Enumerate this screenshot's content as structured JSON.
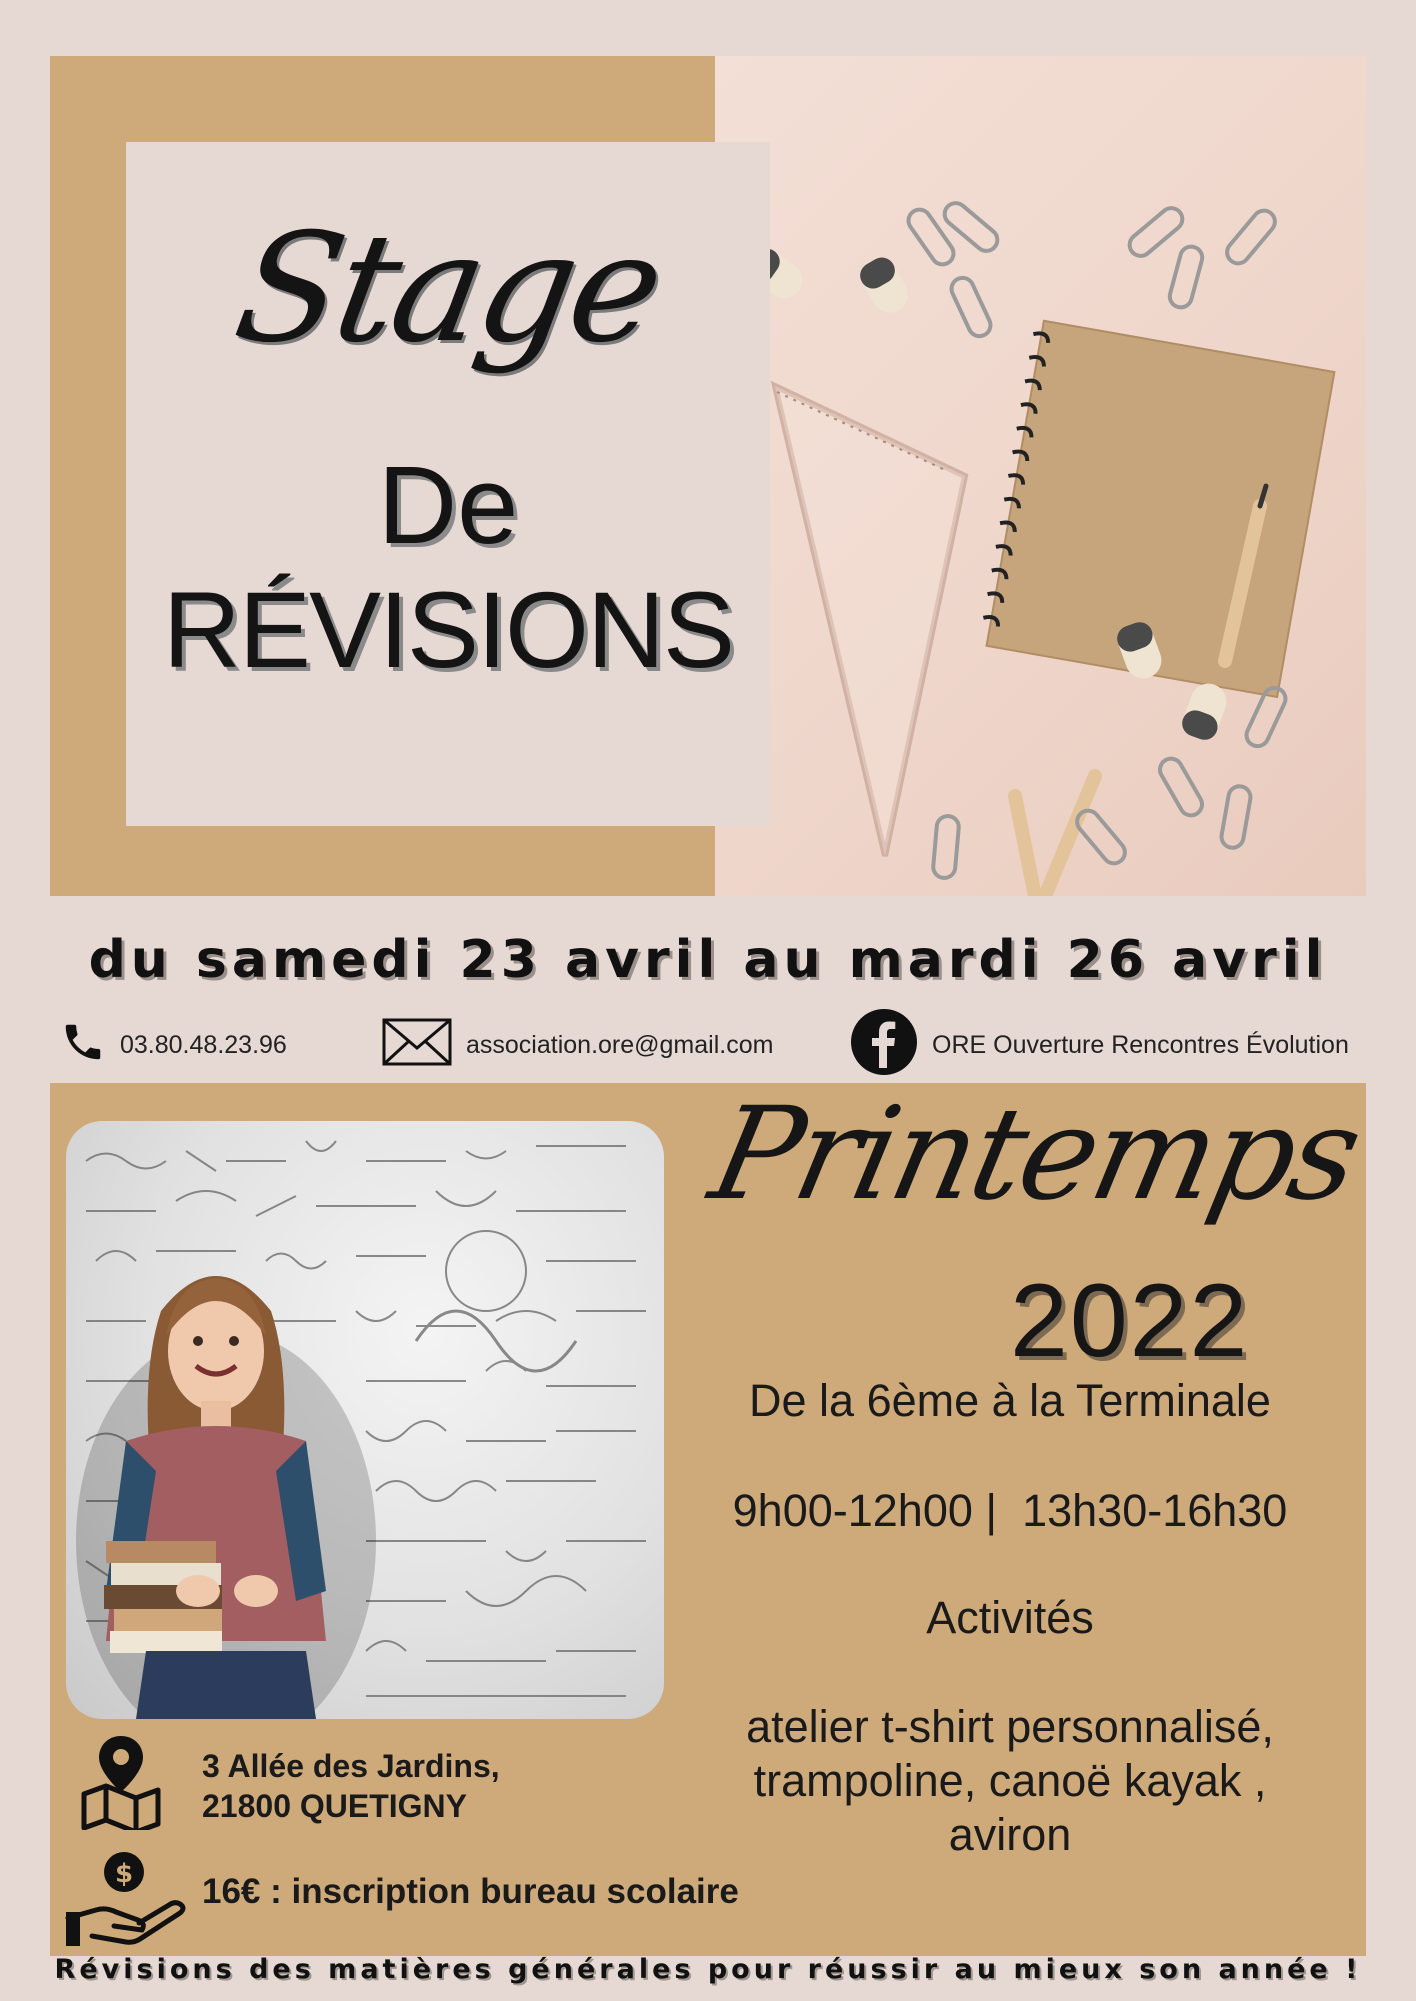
{
  "hero": {
    "title_script": "Stage",
    "title_de": "De",
    "title_main": "RÉVISIONS"
  },
  "dates": "du samedi 23 avril au mardi 26 avril",
  "contact": {
    "phone": "03.80.48.23.96",
    "email": "association.ore@gmail.com",
    "facebook": "ORE Ouverture Rencontres Évolution"
  },
  "season": {
    "script": "Printemps",
    "year": "2022"
  },
  "details": {
    "levels": "De la 6ème à la Terminale",
    "hours": "9h00-12h00 |  13h30-16h30",
    "activities_heading": "Activités",
    "activities_line1": "atelier t-shirt personnalisé,",
    "activities_line2": "trampoline, canoë kayak ,",
    "activities_line3": "aviron"
  },
  "address": {
    "line1": "3 Allée des Jardins,",
    "line2": "21800 QUETIGNY"
  },
  "price": "16€ : inscription bureau scolaire",
  "footer": "Révisions des matières générales pour réussir au mieux son année !",
  "colors": {
    "background": "#e6d9d4",
    "tan": "#cea97a",
    "text": "#111111"
  }
}
